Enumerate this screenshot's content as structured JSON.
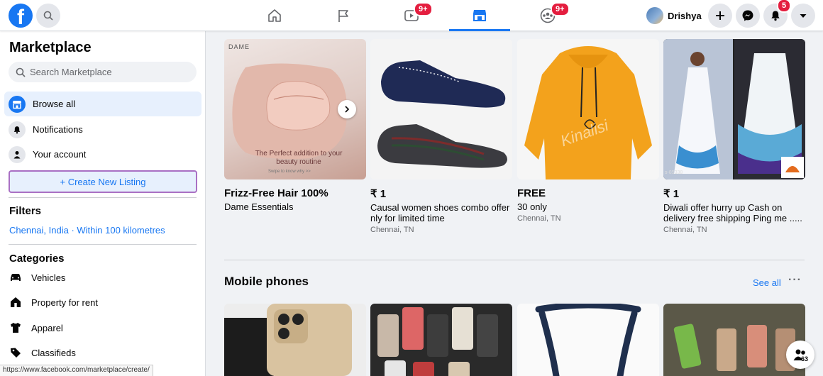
{
  "topbar": {
    "logo_letter": "f",
    "video_badge": "9+",
    "groups_badge": "9+",
    "user_name": "Drishya",
    "notifications_badge": "5"
  },
  "sidebar": {
    "title": "Marketplace",
    "search_placeholder": "Search Marketplace",
    "nav": [
      {
        "label": "Browse all",
        "icon": "storefront-icon"
      },
      {
        "label": "Notifications",
        "icon": "bell-icon"
      },
      {
        "label": "Your account",
        "icon": "person-icon"
      }
    ],
    "create_label": "+ Create New Listing",
    "filters_title": "Filters",
    "filter_location": "Chennai, India · Within 100 kilometres",
    "categories_title": "Categories",
    "categories": [
      {
        "label": "Vehicles",
        "icon": "car-icon"
      },
      {
        "label": "Property for rent",
        "icon": "house-icon"
      },
      {
        "label": "Apparel",
        "icon": "shirt-icon"
      },
      {
        "label": "Classifieds",
        "icon": "tag-icon"
      }
    ]
  },
  "listings": [
    {
      "price": "Frizz-Free Hair 100%",
      "title": "Dame Essentials",
      "location": "",
      "image_text_brand": "DAME",
      "image_text_caption": "The Perfect addition to your beauty routine",
      "image_text_swipe": "Swipe to know why >>"
    },
    {
      "price": "₹ 1",
      "title": "Causal women shoes combo offer nly for limited time",
      "location": "Chennai, TN"
    },
    {
      "price": "FREE",
      "title": "30 only",
      "location": "Chennai, TN",
      "image_text_watermark": "Kinalisi"
    },
    {
      "price": "₹ 1",
      "title": "Diwali offer hurry up Cash on delivery free shipping Ping me .....",
      "location": "Chennai, TN",
      "image_text_code": "s-85338"
    }
  ],
  "section": {
    "title": "Mobile phones",
    "see_all": "See all",
    "more": "···"
  },
  "status_url": "https://www.facebook.com/marketplace/create/",
  "contacts_count": "63",
  "colors": {
    "accent": "#1877f2",
    "badge": "#e41e3f",
    "create_border": "#a970c4"
  }
}
